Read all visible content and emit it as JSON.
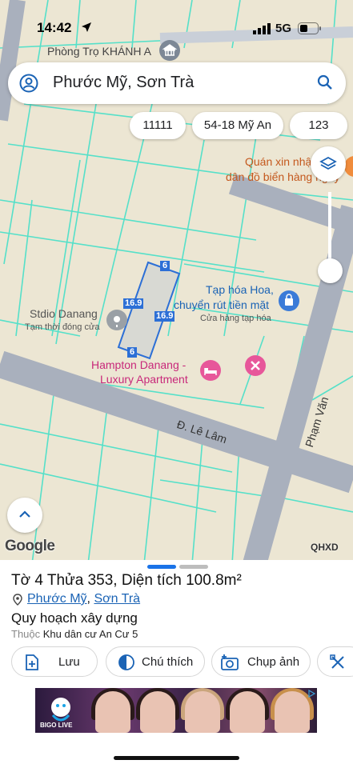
{
  "status": {
    "time": "14:42",
    "network": "5G"
  },
  "search": {
    "query": "Phước Mỹ, Sơn Trà"
  },
  "chips": [
    "11111",
    "54-18 Mỹ An",
    "123"
  ],
  "map": {
    "labels": {
      "phongtro": "Phòng Trọ KHÁNH A",
      "quan_line1": "Quán xin nhậ",
      "quan_line2": "dân đồ biển hàng ngày",
      "taphoa_line1": "Tạp hóa Hoa,",
      "taphoa_line2": "chuyển rút tiền mặt",
      "taphoa_sub": "Cửa hàng tạp hóa",
      "stdio": "Stdio Danang",
      "stdio_sub": "Tạm thời đóng cửa",
      "hampton_line1": "Hampton Danang -",
      "hampton_line2": "Luxury Apartment",
      "road_lelam": "Đ. Lê Lâm",
      "road_phamvan": "Phạm Văn"
    },
    "parcel_dims": {
      "top": "6",
      "left": "16.9",
      "right": "16.9",
      "bottom": "6"
    },
    "attribution": "Google",
    "plus_code": "QHXD"
  },
  "sheet": {
    "title": "Tờ 4 Thửa 353, Diện tích 100.8m²",
    "ward": "Phước Mỹ",
    "district": "Sơn Trà",
    "separator": ", ",
    "plan_title": "Quy hoạch xây dựng",
    "belongs_prefix": "Thuộc",
    "belongs_value": "Khu dân cư An Cư 5",
    "actions": {
      "save": "Lưu",
      "note": "Chú thích",
      "photo": "Chụp ảnh"
    }
  },
  "ad": {
    "brand": "BIGO LIVE"
  },
  "colors": {
    "accent": "#1a63b5",
    "parcel": "#2c6fd6",
    "road": "#a9b0bd",
    "boundary": "#55e0c9"
  }
}
